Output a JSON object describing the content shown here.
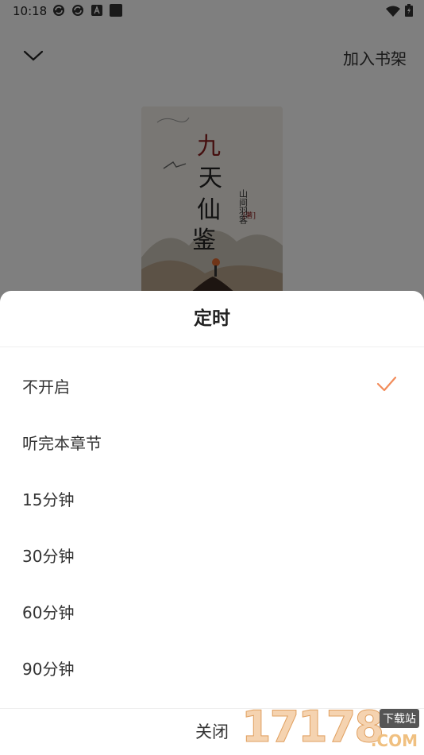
{
  "status_bar": {
    "time": "10:18"
  },
  "top_bar": {
    "add_to_shelf_label": "加入书架"
  },
  "cover": {
    "title_chars": "九天仙鉴",
    "author": "山间羽客",
    "author_tag": "著"
  },
  "sheet": {
    "title": "定时",
    "options": [
      {
        "label": "不开启",
        "selected": true
      },
      {
        "label": "听完本章节",
        "selected": false
      },
      {
        "label": "15分钟",
        "selected": false
      },
      {
        "label": "30分钟",
        "selected": false
      },
      {
        "label": "60分钟",
        "selected": false
      },
      {
        "label": "90分钟",
        "selected": false
      }
    ],
    "close_label": "关闭"
  },
  "watermark": {
    "digits": "17178",
    "tag": "下载站",
    "suffix": ".COM"
  },
  "colors": {
    "accent_check": "#f28c5a",
    "overlay": "rgba(0,0,0,0.5)"
  }
}
